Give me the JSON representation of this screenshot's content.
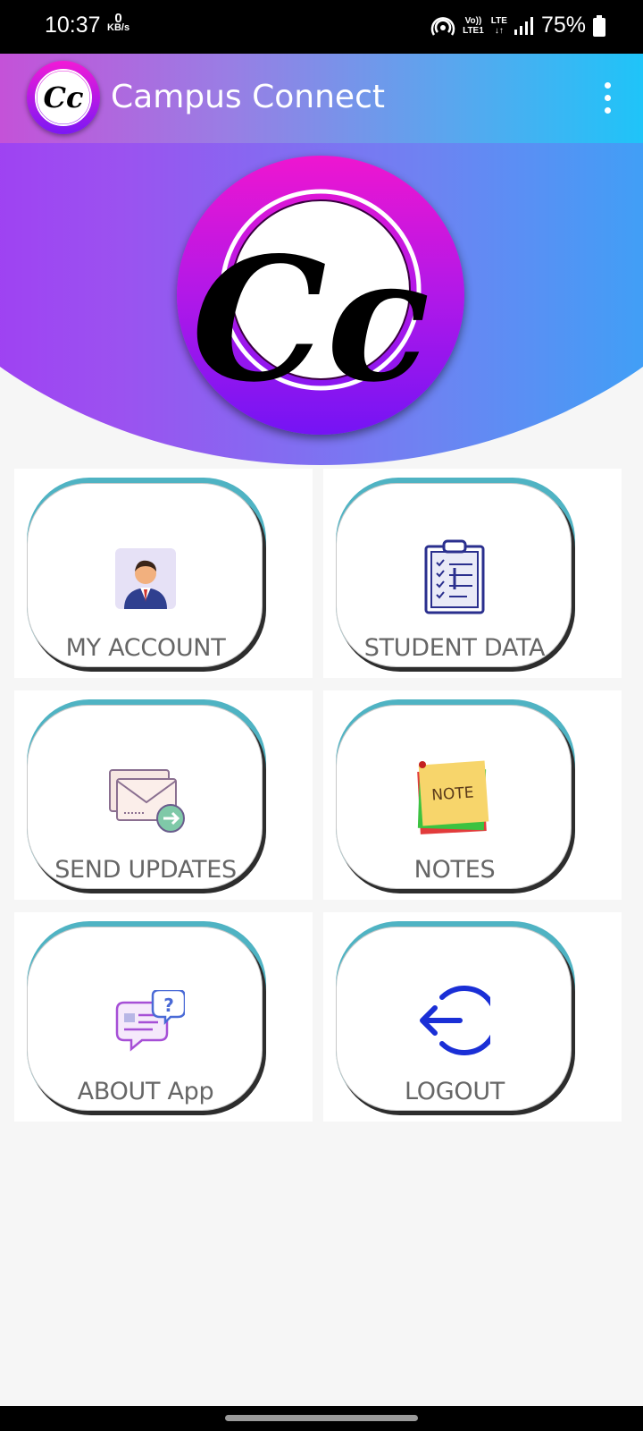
{
  "status_bar": {
    "time": "10:37",
    "speed_value": "0",
    "speed_unit": "KB/s",
    "volte_top": "Vo))",
    "volte_bottom": "LTE1",
    "network": "LTE",
    "battery": "75%"
  },
  "app_bar": {
    "title": "Campus Connect",
    "logo_text": "Cc"
  },
  "header": {
    "logo_text": "Cc",
    "gradient_colors": [
      "#a42cf6",
      "#1cb6f9"
    ]
  },
  "menu": [
    {
      "label": "MY ACCOUNT",
      "icon": "account-icon"
    },
    {
      "label": "STUDENT DATA",
      "icon": "clipboard-icon"
    },
    {
      "label": "SEND UPDATES",
      "icon": "send-mail-icon"
    },
    {
      "label": "NOTES",
      "icon": "note-icon",
      "icon_text": "NOTE"
    },
    {
      "label": "ABOUT App",
      "icon": "about-chat-icon"
    },
    {
      "label": "LOGOUT",
      "icon": "logout-icon"
    }
  ],
  "colors": {
    "tile_accent": "#4fb3c3",
    "label_text": "#666666",
    "background": "#f6f6f6"
  }
}
